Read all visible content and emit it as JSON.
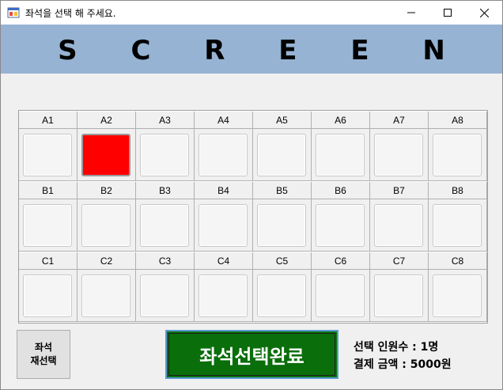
{
  "window": {
    "title": "좌석을 선택 해 주세요."
  },
  "screen": {
    "label": "S C R E E N"
  },
  "seats": {
    "rows": [
      {
        "row": "A",
        "labels": [
          "A1",
          "A2",
          "A3",
          "A4",
          "A5",
          "A6",
          "A7",
          "A8"
        ]
      },
      {
        "row": "B",
        "labels": [
          "B1",
          "B2",
          "B3",
          "B4",
          "B5",
          "B6",
          "B7",
          "B8"
        ]
      },
      {
        "row": "C",
        "labels": [
          "C1",
          "C2",
          "C3",
          "C4",
          "C5",
          "C6",
          "C7",
          "C8"
        ]
      }
    ],
    "selected": [
      "A2"
    ],
    "selected_color": "#ff0000"
  },
  "buttons": {
    "reset_label": "좌석\n재선택",
    "done_label": "좌석선택완료"
  },
  "summary": {
    "count_text": "선택 인원수 : 1명",
    "price_text": "결제 금액 : 5000원"
  },
  "colors": {
    "screen_band": "#97b3d3",
    "done_button": "#0a6e0a"
  }
}
